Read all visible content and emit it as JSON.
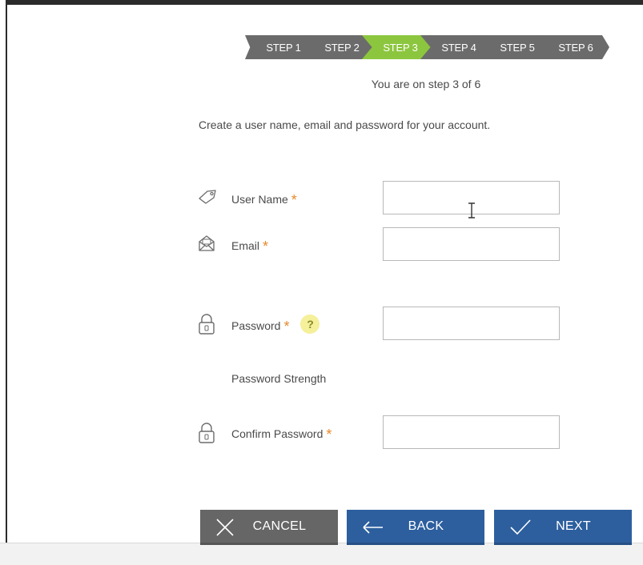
{
  "colors": {
    "step_active": "#8cc63f",
    "step_inactive": "#6b6b6b",
    "required": "#e58a2b",
    "cancel": "#666666",
    "primary": "#2d5f9e"
  },
  "stepper": {
    "steps": [
      {
        "label": "STEP 1",
        "active": false
      },
      {
        "label": "STEP 2",
        "active": false
      },
      {
        "label": "STEP 3",
        "active": true
      },
      {
        "label": "STEP 4",
        "active": false
      },
      {
        "label": "STEP 5",
        "active": false
      },
      {
        "label": "STEP 6",
        "active": false
      }
    ],
    "status": "You are on step 3 of 6"
  },
  "intro": "Create a user name, email and password for your account.",
  "form": {
    "required_mark": "*",
    "username": {
      "label": "User Name",
      "icon": "tag-icon",
      "value": "",
      "placeholder": ""
    },
    "email": {
      "label": "Email",
      "icon": "envelope-icon",
      "value": "",
      "placeholder": ""
    },
    "password": {
      "label": "Password",
      "icon": "lock-icon",
      "help": "?",
      "value": "",
      "placeholder": ""
    },
    "password_strength": "Password Strength",
    "confirm_password": {
      "label": "Confirm Password",
      "icon": "lock-icon",
      "value": "",
      "placeholder": ""
    }
  },
  "buttons": {
    "cancel": {
      "label": "CANCEL",
      "icon": "close-icon"
    },
    "back": {
      "label": "BACK",
      "icon": "arrow-left-icon"
    },
    "next": {
      "label": "NEXT",
      "icon": "check-icon"
    }
  }
}
